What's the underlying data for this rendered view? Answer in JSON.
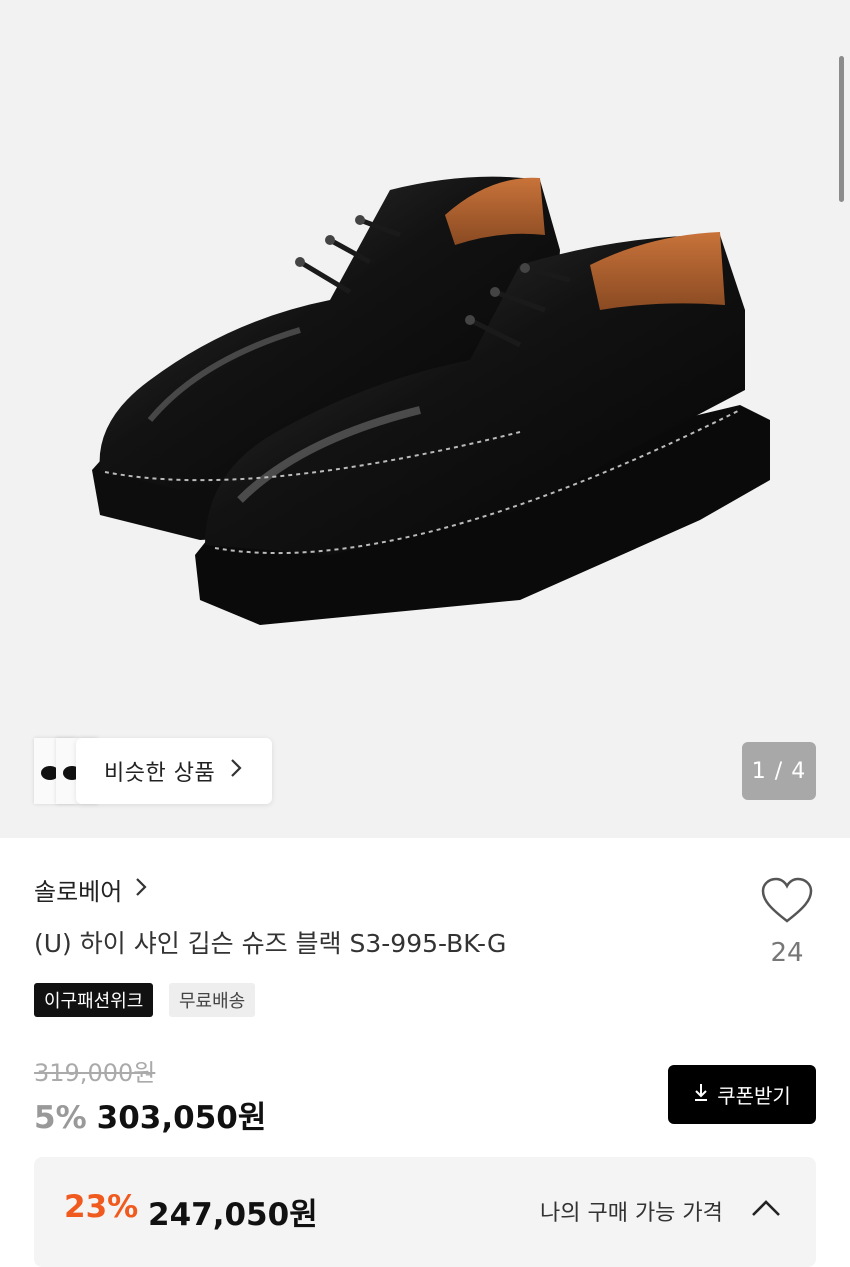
{
  "gallery": {
    "similar_label": "비슷한 상품",
    "pager": "1 / 4"
  },
  "product": {
    "brand": "솔로베어",
    "title": "(U) 하이 샤인 깁슨 슈즈 블랙 S3-995-BK-G",
    "likes": "24",
    "badges": [
      "이구패션위크",
      "무료배송"
    ],
    "original_price": "319,000원",
    "discount_percent": "5%",
    "sale_price": "303,050원",
    "coupon_button": "쿠폰받기"
  },
  "best_price": {
    "discount_percent": "23%",
    "price": "247,050원",
    "label": "나의 구매 가능 가격"
  },
  "colors": {
    "accent": "#f05a1e",
    "dark": "#111111"
  }
}
